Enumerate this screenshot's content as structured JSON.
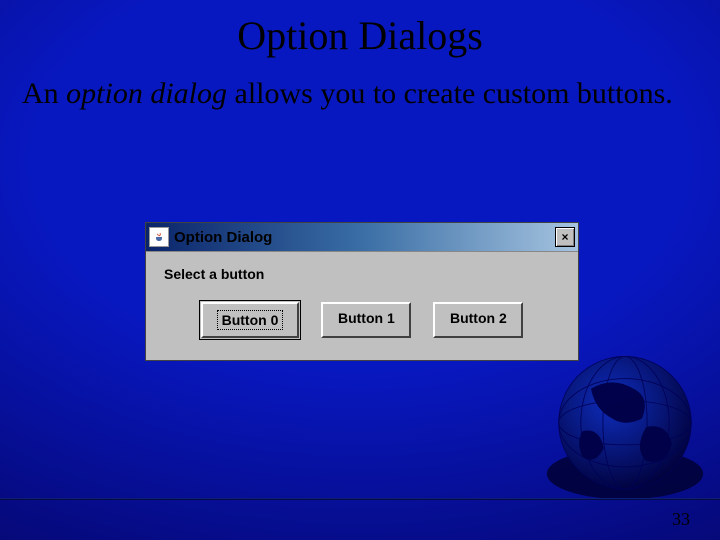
{
  "title": "Option Dialogs",
  "body_prefix": "An ",
  "body_italic": "option dialog",
  "body_suffix": " allows you to create custom buttons.",
  "dialog": {
    "title": "Option Dialog",
    "close_glyph": "×",
    "prompt": "Select a button",
    "buttons": [
      "Button 0",
      "Button 1",
      "Button 2"
    ]
  },
  "page_number": "33"
}
